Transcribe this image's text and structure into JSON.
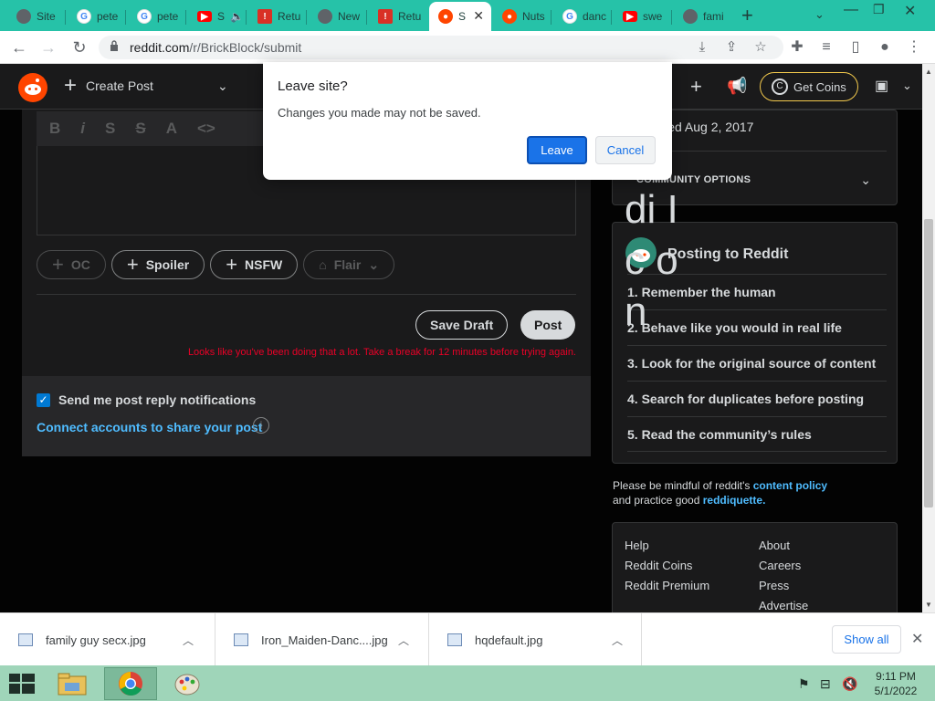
{
  "browser": {
    "tabs": [
      {
        "label": "Site",
        "icon": "chrome-icon"
      },
      {
        "label": "pete",
        "icon": "google-icon"
      },
      {
        "label": "pete",
        "icon": "google-icon"
      },
      {
        "label": "S",
        "icon": "youtube-icon"
      },
      {
        "label": "Retu",
        "icon": "return-icon"
      },
      {
        "label": "New",
        "icon": "chrome-icon"
      },
      {
        "label": "Retu",
        "icon": "return-icon"
      },
      {
        "label": "S",
        "icon": "reddit-icon"
      },
      {
        "label": "Nuts",
        "icon": "reddit-icon"
      },
      {
        "label": "danc",
        "icon": "google-icon"
      },
      {
        "label": "swe",
        "icon": "youtube-icon"
      },
      {
        "label": "fami",
        "icon": "chrome-icon"
      }
    ],
    "url_host": "reddit.com",
    "url_path": "/r/BrickBlock/submit"
  },
  "reddit": {
    "create_post": "Create Post",
    "get_coins": "Get Coins",
    "format_bar": [
      "B",
      "i",
      "S",
      "S",
      "A",
      "<>"
    ],
    "pills": {
      "oc": "OC",
      "spoiler": "Spoiler",
      "nsfw": "NSFW",
      "flair": "Flair"
    },
    "save_draft": "Save Draft",
    "post": "Post",
    "warning": "Looks like you've been doing that a lot. Take a break for 12 minutes before trying again.",
    "notif_label": "Send me post reply notifications",
    "connect": "Connect accounts to share your post"
  },
  "sidebar": {
    "created": "Created Aug 2, 2017",
    "community_options": "COMMUNITY OPTIONS",
    "posting_title": "Posting to Reddit",
    "rules": [
      "1. Remember the human",
      "2. Behave like you would in real life",
      "3. Look for the original source of content",
      "4. Search for duplicates before posting",
      "5. Read the community’s rules"
    ],
    "alt_text": "di Ic on",
    "mindful_1": "Please be mindful of reddit's",
    "content_policy": "content policy",
    "mindful_2": "and practice good",
    "reddiquette": "reddiquette.",
    "footer_left": [
      "Help",
      "Reddit Coins",
      "Reddit Premium"
    ],
    "footer_right": [
      "About",
      "Careers",
      "Press",
      "Advertise"
    ]
  },
  "dialog": {
    "title": "Leave site?",
    "message": "Changes you made may not be saved.",
    "leave": "Leave",
    "cancel": "Cancel"
  },
  "downloads": {
    "items": [
      "family guy secx.jpg",
      "Iron_Maiden-Danc....jpg",
      "hqdefault.jpg"
    ],
    "show_all": "Show all"
  },
  "taskbar": {
    "time": "9:11 PM",
    "date": "5/1/2022"
  },
  "colors": {
    "tab_strip": "#26c2a8",
    "reddit_bg": "#030303",
    "accent_blue": "#1a73e8",
    "warning_red": "#ea0027"
  }
}
